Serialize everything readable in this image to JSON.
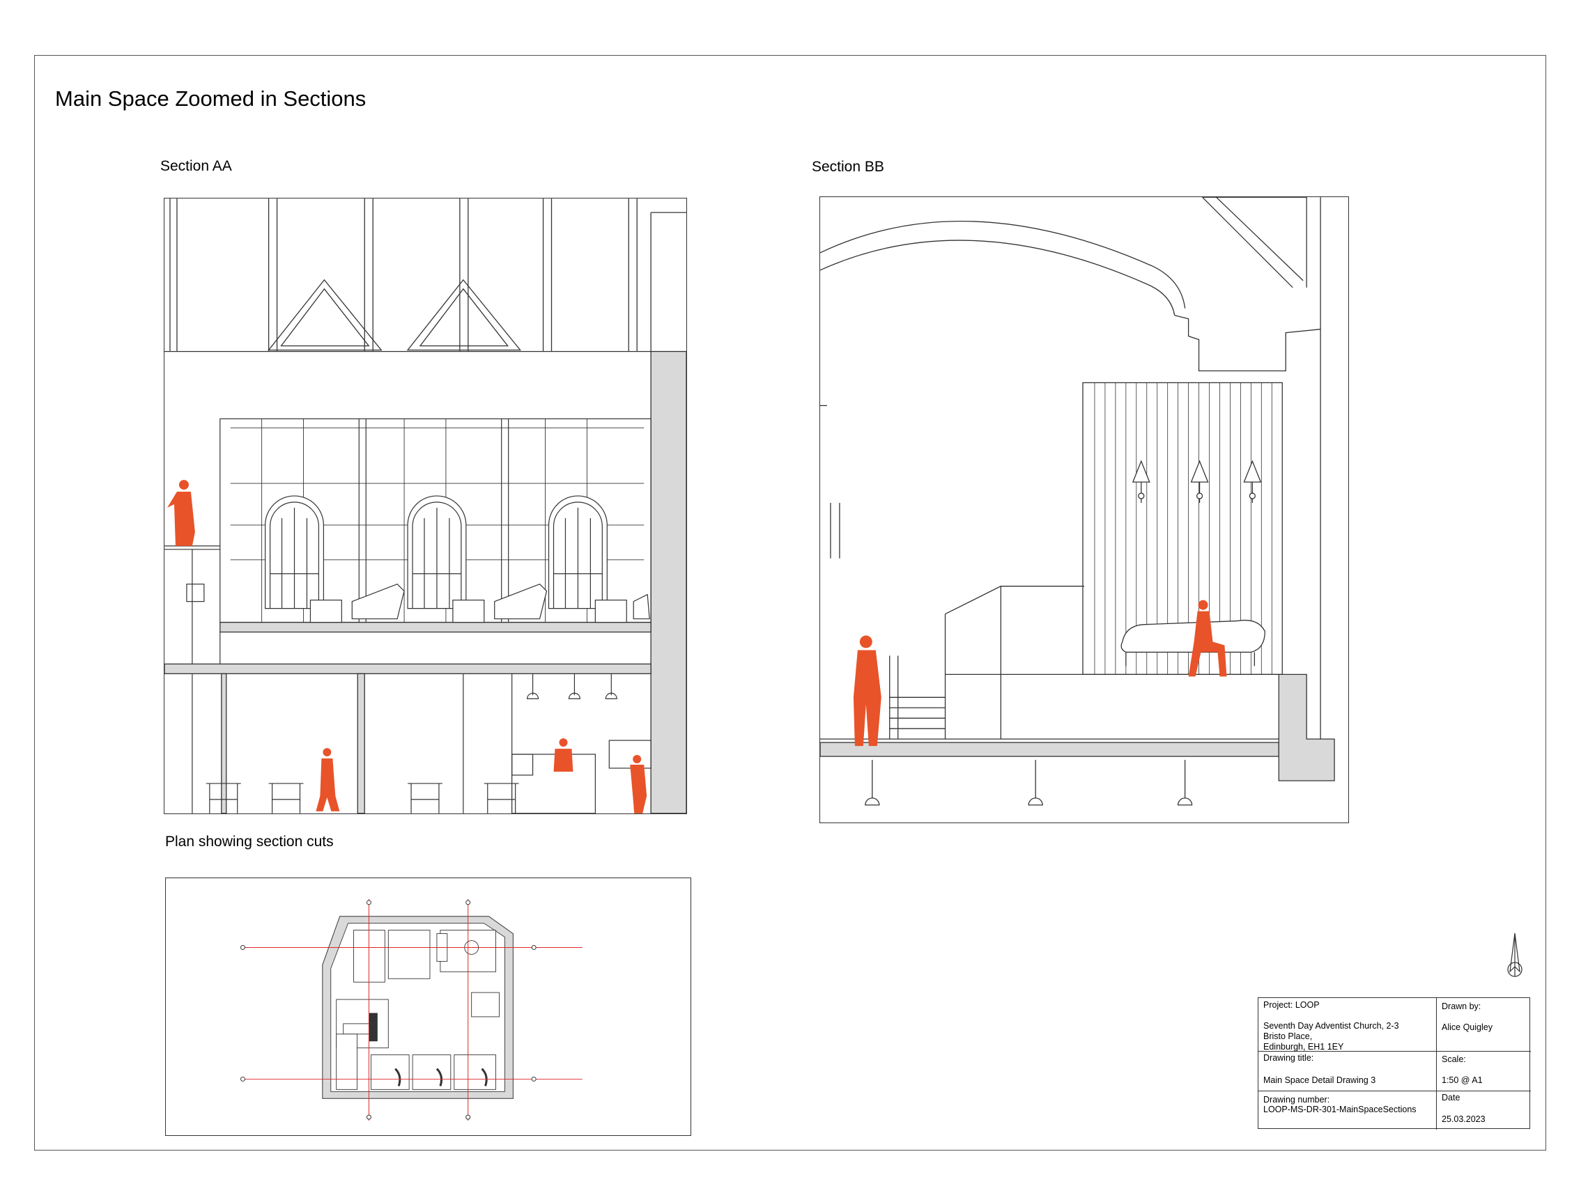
{
  "sheet_title": "Main Space Zoomed in Sections",
  "labels": {
    "section_aa": "Section AA",
    "section_bb": "Section BB",
    "plan": "Plan showing section cuts"
  },
  "title_block": {
    "project": "Project: LOOP",
    "address": "Seventh Day Adventist Church, 2-3\nBristo Place,\nEdinburgh, EH1 1EY",
    "drawn_by_label": "Drawn by:",
    "drawn_by": "Alice Quigley",
    "drawing_title_label": "Drawing title:",
    "drawing_title": "Main Space Detail Drawing 3",
    "scale_label": "Scale:",
    "scale": "1:50 @ A1",
    "drawing_number_label": "Drawing number:",
    "drawing_number": "LOOP-MS-DR-301-MainSpaceSections",
    "date_label": "Date",
    "date": "25.03.2023"
  },
  "colors": {
    "figure": "#e8532a",
    "wall_fill": "#d9d9d9",
    "line": "#333333",
    "section_cut": "#e0262a"
  },
  "icons": [
    "north-arrow-icon"
  ]
}
